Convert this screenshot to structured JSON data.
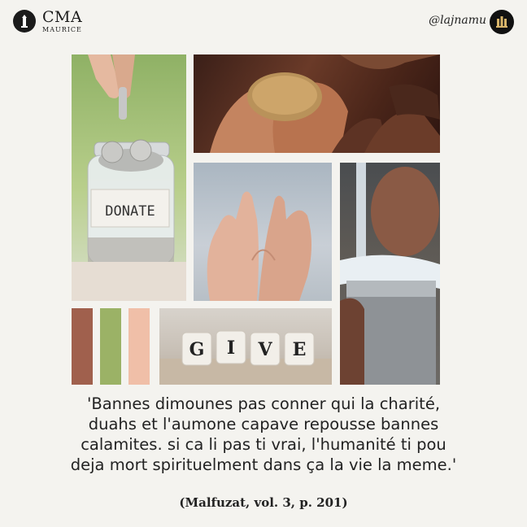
{
  "header": {
    "logo_title": "CMA",
    "logo_subtitle": "MAURICE",
    "handle": "@lajnamu"
  },
  "tiles": {
    "donate_label": "DONATE",
    "give_letters": [
      "G",
      "I",
      "V",
      "E"
    ]
  },
  "palette": [
    "#a0604d",
    "#9bb266",
    "#f0bfa8"
  ],
  "quote": {
    "lines": [
      "'Bannes dimounes pas conner qui la charité,",
      "duahs et l'aumone capave repousse bannes",
      "calamites. si ca li pas ti vrai, l'humanité ti pou",
      "deja mort spirituelment dans ça la vie la meme.'"
    ],
    "citation": "(Malfuzat, vol. 3, p. 201)"
  }
}
